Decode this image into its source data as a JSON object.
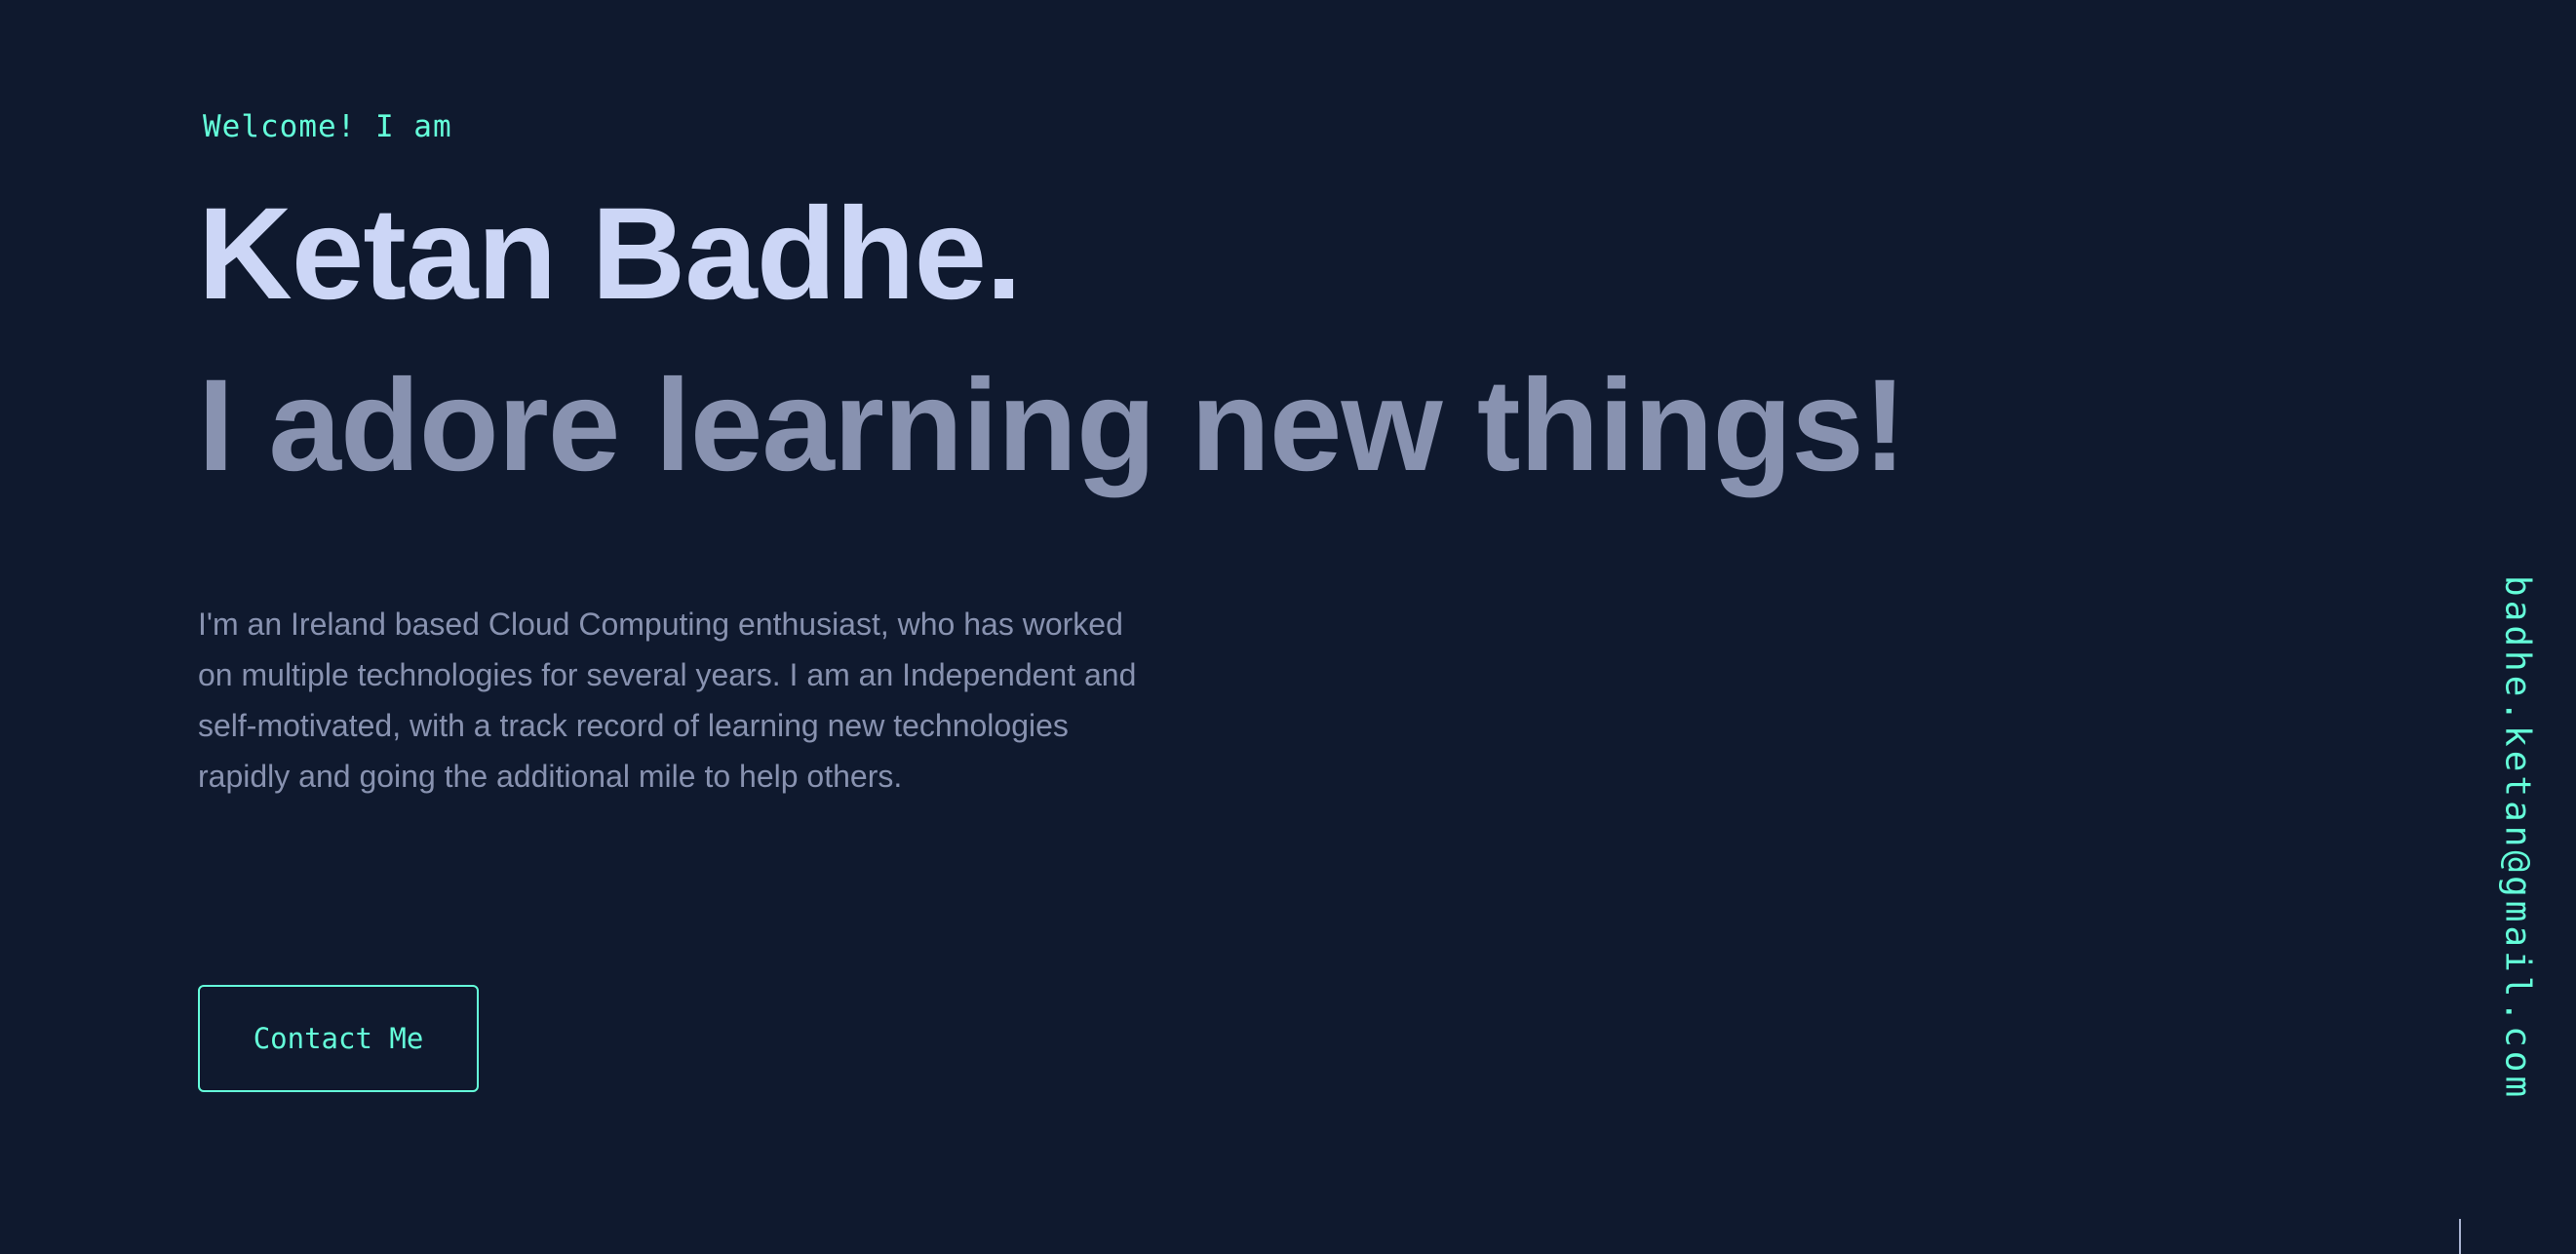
{
  "hero": {
    "greeting": "Welcome! I am",
    "name": "Ketan Badhe.",
    "tagline": "I adore learning new things!",
    "bio": "I'm an Ireland based Cloud Computing enthusiast, who has worked on multiple technologies for several years. I am an Independent and self-motivated, with a track record of learning new technologies rapidly and going the additional mile to help others.",
    "contact_label": "Contact Me"
  },
  "side": {
    "email": "badhe.ketan@gmail.com"
  },
  "colors": {
    "background": "#0f192e",
    "accent": "#64ffda",
    "heading": "#ccd6f6",
    "muted": "#8892b0"
  }
}
